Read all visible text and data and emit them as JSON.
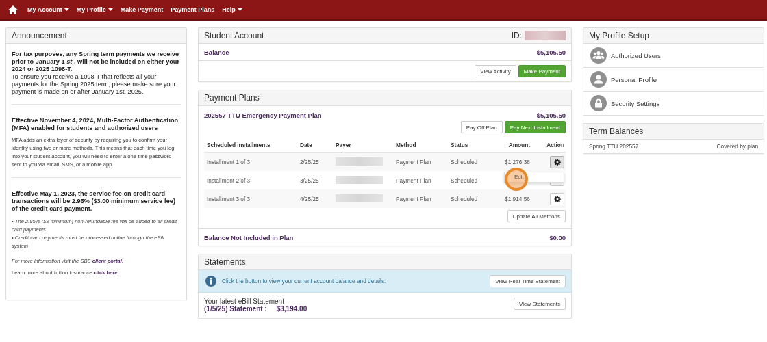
{
  "nav": {
    "items": [
      {
        "label": "My Account",
        "dropdown": true
      },
      {
        "label": "My Profile",
        "dropdown": true
      },
      {
        "label": "Make Payment",
        "dropdown": false
      },
      {
        "label": "Payment Plans",
        "dropdown": false
      },
      {
        "label": "Help",
        "dropdown": true
      }
    ]
  },
  "announcement": {
    "title": "Announcement",
    "blocks": [
      {
        "kind": "heading",
        "text": "For tax purposes, any Spring term payments we receive prior to January 1 *st* , will not be included on either your 2024 or 2025 1098-T."
      },
      {
        "kind": "lead",
        "text": "To ensure you receive a 1098-T that reflects all your payments for the Spring 2025 term, please make sure your payment is made on or after January 1st, 2025."
      },
      {
        "kind": "divider"
      },
      {
        "kind": "heading",
        "text": "Effective November 4, 2024, Multi-Factor Authentication (MFA) enabled for students and authorized users"
      },
      {
        "kind": "body",
        "text": "MFA adds an extra layer of security by requiring you to confirm your identity using two or more methods. This means that each time you log into your student account, you will need to enter a one-time password sent to you via email, SMS, or a mobile app."
      },
      {
        "kind": "divider"
      },
      {
        "kind": "heading",
        "text": "Effective May 1, 2023, the service fee on credit card transactions will be 2.95% ($3.00 minimum service fee) of the credit card payment."
      },
      {
        "kind": "bullet",
        "text": "• The 2.95% ($3 minimum) non-refundable fee will be added to all credit card payments"
      },
      {
        "kind": "bullet",
        "text": "• Credit card payments must be processed online through the eBill system"
      },
      {
        "kind": "link_note",
        "before": "For more information visit the SBS ",
        "link": "client portal",
        "after": "."
      },
      {
        "kind": "link_line",
        "before": "Learn more about tuition insurance ",
        "link": "click here",
        "after": "."
      }
    ]
  },
  "student_account": {
    "title": "Student Account",
    "id_label": "ID:",
    "balance_label": "Balance",
    "balance": "$5,105.50",
    "buttons": [
      {
        "label": "View Activity",
        "kind": "default"
      },
      {
        "label": "Make Payment",
        "kind": "primary"
      }
    ]
  },
  "payment_plans": {
    "title": "Payment Plans",
    "plan_name": "202557 TTU Emergency Payment Plan",
    "plan_amount": "$5,105.50",
    "buttons": [
      {
        "label": "Pay Off Plan",
        "kind": "default"
      },
      {
        "label": "Pay Next Installment",
        "kind": "primary"
      }
    ],
    "columns": [
      "Scheduled installments",
      "Date",
      "Payer",
      "Method",
      "Status",
      "Amount",
      "Action"
    ],
    "rows": [
      {
        "installment": "Installment 1 of 3",
        "date": "2/25/25",
        "method": "Payment Plan",
        "status": "Scheduled",
        "amount": "$1,276.38",
        "menu_open": true
      },
      {
        "installment": "Installment 2 of 3",
        "date": "3/25/25",
        "method": "Payment Plan",
        "status": "Scheduled",
        "menu_open": false
      },
      {
        "installment": "Installment 3 of 3",
        "date": "4/25/25",
        "method": "Payment Plan",
        "status": "Scheduled",
        "amount": "$1,914.56",
        "menu_open": false
      }
    ],
    "menu": {
      "items": [
        {
          "label": "Edit",
          "highlighted": true
        }
      ]
    },
    "update_button": "Update All Methods",
    "not_included_label": "Balance Not Included in Plan",
    "not_included_amount": "$0.00"
  },
  "statements": {
    "title": "Statements",
    "info": "Click the button to view your current account balance and details.",
    "info_button": "View Real-Time Statement",
    "latest_label": "Your latest eBill Statement",
    "statement_label": "(1/5/25) Statement :",
    "statement_amount": "$3,194.00",
    "view_button": "View Statements"
  },
  "profile_setup": {
    "title": "My Profile Setup",
    "items": [
      {
        "label": "Authorized Users",
        "kind": "users"
      },
      {
        "label": "Personal Profile",
        "kind": "person"
      },
      {
        "label": "Security Settings",
        "kind": "lock"
      }
    ]
  },
  "term_balances": {
    "title": "Term Balances",
    "rows": [
      {
        "term": "Spring TTU 202557",
        "status": "Covered by plan"
      }
    ]
  }
}
